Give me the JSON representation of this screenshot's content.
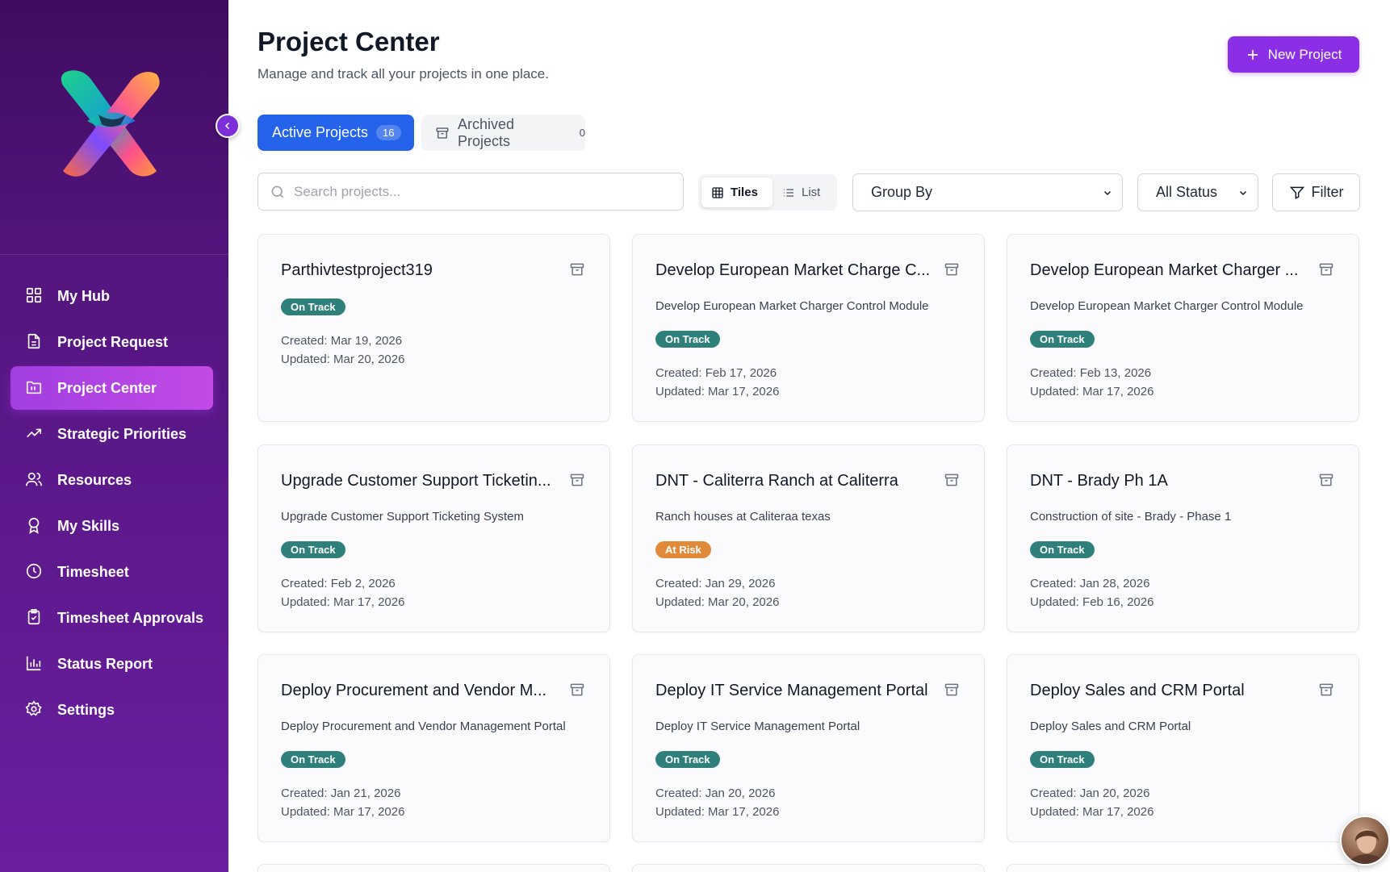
{
  "sidebar": {
    "items": [
      {
        "label": "My Hub",
        "icon": "grid-icon",
        "active": false
      },
      {
        "label": "Project Request",
        "icon": "document-icon",
        "active": false
      },
      {
        "label": "Project Center",
        "icon": "folder-icon",
        "active": true
      },
      {
        "label": "Strategic Priorities",
        "icon": "trending-up-icon",
        "active": false
      },
      {
        "label": "Resources",
        "icon": "users-icon",
        "active": false
      },
      {
        "label": "My Skills",
        "icon": "award-icon",
        "active": false
      },
      {
        "label": "Timesheet",
        "icon": "clock-icon",
        "active": false
      },
      {
        "label": "Timesheet Approvals",
        "icon": "clipboard-check-icon",
        "active": false
      },
      {
        "label": "Status Report",
        "icon": "bar-chart-icon",
        "active": false
      },
      {
        "label": "Settings",
        "icon": "gear-icon",
        "active": false
      }
    ]
  },
  "header": {
    "title": "Project Center",
    "subtitle": "Manage and track all your projects in one place.",
    "new_project_label": "New Project"
  },
  "tabs": {
    "active": {
      "label": "Active Projects",
      "count": "16"
    },
    "archived": {
      "label": "Archived Projects",
      "count": "0"
    }
  },
  "toolbar": {
    "search_placeholder": "Search projects...",
    "view_tiles": "Tiles",
    "view_list": "List",
    "group_by": "Group By",
    "status": "All Status",
    "filter": "Filter"
  },
  "colors": {
    "accent": "#8b2fe6",
    "primary_blue": "#2563eb",
    "on_track": "#2f7f7a",
    "at_risk": "#e08a3a"
  },
  "projects": [
    {
      "title": "Parthivtestproject319",
      "description": "",
      "status": "On Track",
      "created": "Created: Mar 19, 2026",
      "updated": "Updated: Mar 20, 2026"
    },
    {
      "title": "Develop European Market Charge C...",
      "description": "Develop European Market Charger Control Module",
      "status": "On Track",
      "created": "Created: Feb 17, 2026",
      "updated": "Updated: Mar 17, 2026"
    },
    {
      "title": "Develop European Market Charger ...",
      "description": "Develop European Market Charger Control Module",
      "status": "On Track",
      "created": "Created: Feb 13, 2026",
      "updated": "Updated: Mar 17, 2026"
    },
    {
      "title": "Upgrade Customer Support Ticketin...",
      "description": "Upgrade Customer Support Ticketing System",
      "status": "On Track",
      "created": "Created: Feb 2, 2026",
      "updated": "Updated: Mar 17, 2026"
    },
    {
      "title": "DNT - Caliterra Ranch at Caliterra",
      "description": "Ranch houses at Caliteraa texas",
      "status": "At Risk",
      "created": "Created: Jan 29, 2026",
      "updated": "Updated: Mar 20, 2026"
    },
    {
      "title": "DNT - Brady Ph 1A",
      "description": "Construction of site - Brady - Phase 1",
      "status": "On Track",
      "created": "Created: Jan 28, 2026",
      "updated": "Updated: Feb 16, 2026"
    },
    {
      "title": "Deploy Procurement and Vendor M...",
      "description": "Deploy Procurement and Vendor Management Portal",
      "status": "On Track",
      "created": "Created: Jan 21, 2026",
      "updated": "Updated: Mar 17, 2026"
    },
    {
      "title": "Deploy IT Service Management Portal",
      "description": "Deploy IT Service Management Portal",
      "status": "On Track",
      "created": "Created: Jan 20, 2026",
      "updated": "Updated: Mar 17, 2026"
    },
    {
      "title": "Deploy Sales and CRM Portal",
      "description": "Deploy Sales and CRM Portal",
      "status": "On Track",
      "created": "Created: Jan 20, 2026",
      "updated": "Updated: Mar 17, 2026"
    }
  ]
}
